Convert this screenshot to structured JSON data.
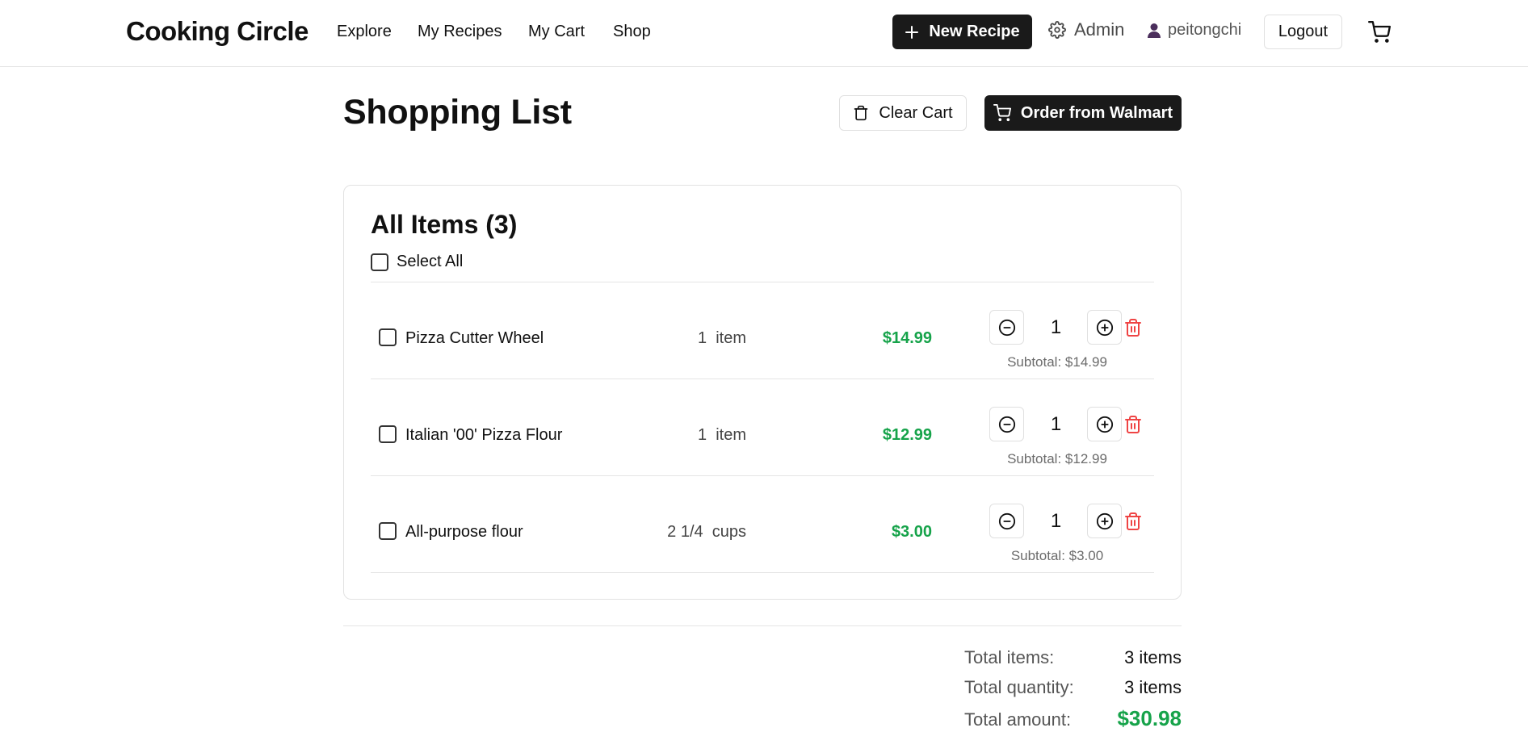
{
  "navbar": {
    "brand": "Cooking Circle",
    "links": [
      "Explore",
      "My Recipes",
      "My Cart",
      "Shop"
    ],
    "new_recipe": "New Recipe",
    "admin": "Admin",
    "username": "peitongchi",
    "logout": "Logout"
  },
  "header": {
    "title": "Shopping List",
    "clear_cart": "Clear Cart",
    "order": "Order from Walmart"
  },
  "cart": {
    "title": "All Items (3)",
    "select_all": "Select All",
    "items": [
      {
        "name": "Pizza Cutter Wheel",
        "amount": "1",
        "unit": "item",
        "price": "$14.99",
        "quantity": "1",
        "subtotal": "Subtotal: $14.99"
      },
      {
        "name": "Italian '00' Pizza Flour",
        "amount": "1",
        "unit": "item",
        "price": "$12.99",
        "quantity": "1",
        "subtotal": "Subtotal: $12.99"
      },
      {
        "name": "All-purpose flour",
        "amount": "2 1/4",
        "unit": "cups",
        "price": "$3.00",
        "quantity": "1",
        "subtotal": "Subtotal: $3.00"
      }
    ]
  },
  "totals": {
    "items_label": "Total items:",
    "items_value": "3 items",
    "quantity_label": "Total quantity:",
    "quantity_value": "3 items",
    "amount_label": "Total amount:",
    "amount_value": "$30.98"
  },
  "colors": {
    "accent_dark": "#1a1a1a",
    "price_green": "#16a34a",
    "delete_red": "#ef4444"
  },
  "icons": {
    "new_recipe": "plus-icon",
    "admin": "gear-icon",
    "user": "user-icon",
    "cart": "cart-icon",
    "clear_cart": "trash-icon",
    "order": "cart-icon",
    "decrement": "minus-circle-icon",
    "increment": "plus-circle-icon",
    "delete": "trash-icon"
  }
}
